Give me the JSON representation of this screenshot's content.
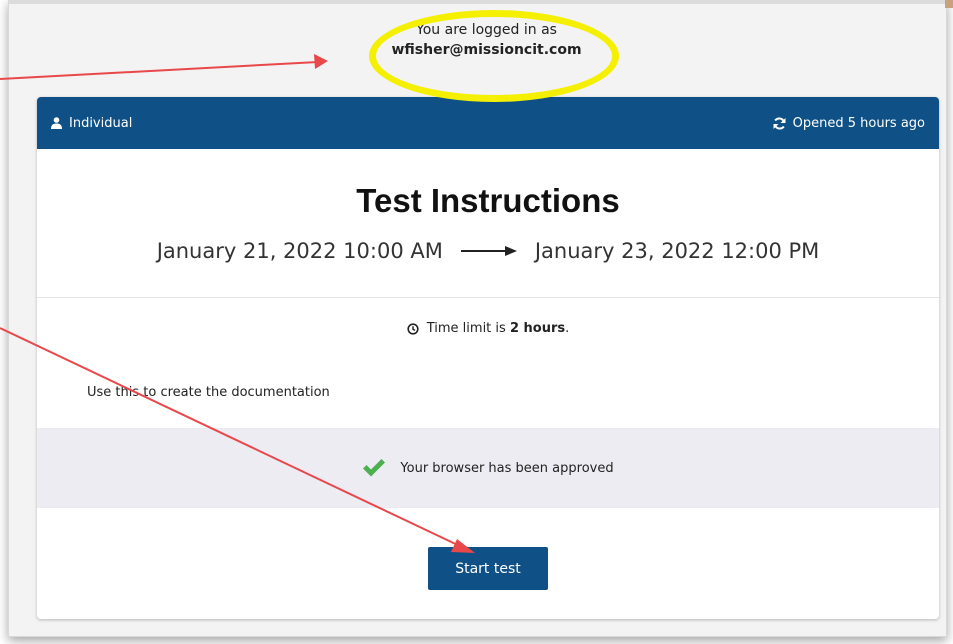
{
  "login": {
    "prefix": "You are logged in as",
    "email": "wfisher@missioncit.com"
  },
  "header": {
    "mode_label": "Individual",
    "opened_label": "Opened 5 hours ago"
  },
  "test": {
    "title": "Test Instructions",
    "start_date": "January 21, 2022 10:00 AM",
    "end_date": "January 23, 2022 12:00 PM",
    "time_limit_prefix": "Time limit is",
    "time_limit_value": "2 hours",
    "time_limit_suffix": ".",
    "description": "Use this to create the documentation",
    "browser_status": "Your browser has been approved",
    "start_button_label": "Start test"
  },
  "colors": {
    "header_bg": "#0f5186",
    "button_bg": "#0f5186",
    "highlight": "#f5f000",
    "annotation_arrow": "#e8484a",
    "check": "#4caf50"
  },
  "icons": {
    "header_left": "person-icon",
    "header_right": "refresh-icon",
    "time_limit": "clock-icon",
    "browser_status": "check-icon"
  }
}
